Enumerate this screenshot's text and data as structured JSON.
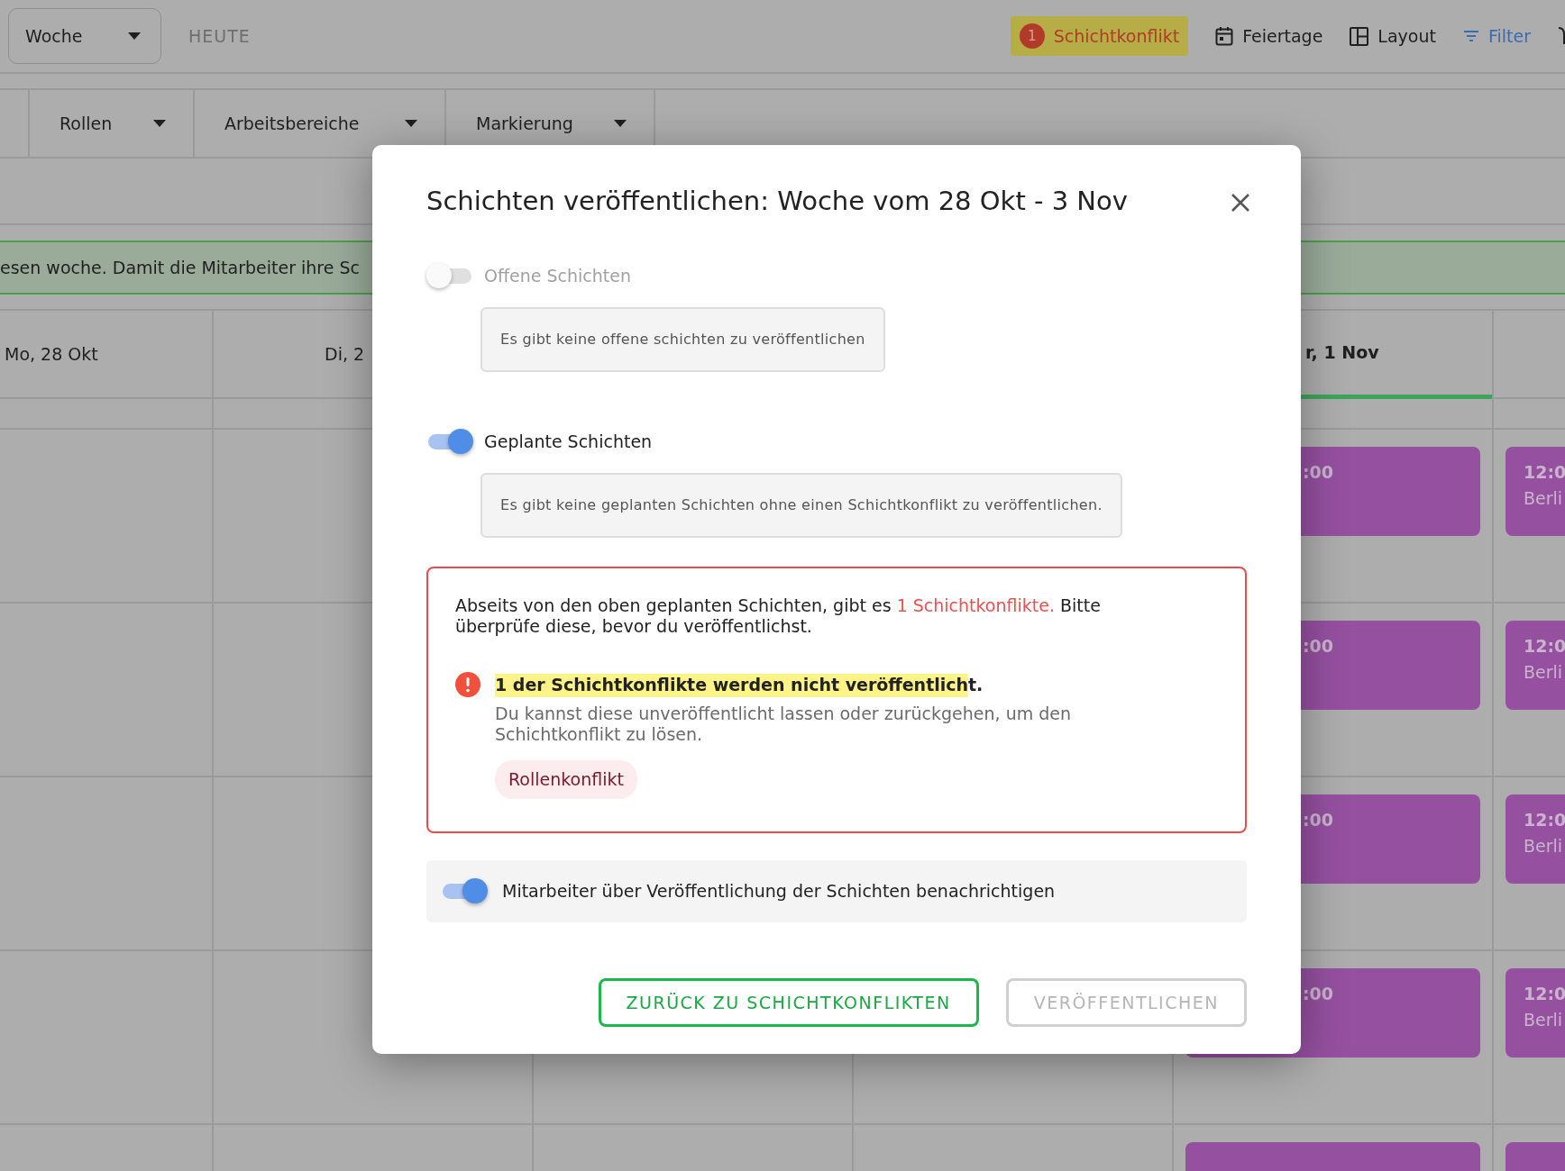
{
  "toolbar": {
    "view_select": "Woche",
    "today": "HEUTE",
    "conflict_count": "1",
    "conflict_label": "Schichtkonflikt",
    "holidays": "Feiertage",
    "layout": "Layout",
    "filter": "Filter"
  },
  "filters": [
    "Rollen",
    "Arbeitsbereiche",
    "Markierung"
  ],
  "banner": "esen woche. Damit die Mitarbeiter ihre Sc",
  "days": [
    {
      "label": "Mo, 28 Okt",
      "selected": false
    },
    {
      "label": "Di, 2",
      "selected": false
    },
    {
      "label": "r, 1 Nov",
      "selected": true,
      "shifts": [
        {
          "time": ":00"
        },
        {
          "time": ":00"
        },
        {
          "time": ":00"
        },
        {
          "time": ":00"
        },
        {
          "kind": "clipped"
        }
      ]
    },
    {
      "selected": false,
      "shifts": [
        {
          "time": "12:0",
          "place": "Berli"
        },
        {
          "time": "12:0",
          "place": "Berli"
        },
        {
          "time": "12:0",
          "place": "Berli"
        },
        {
          "time": "12:0",
          "place": "Berli"
        },
        {
          "kind": "clipped"
        }
      ]
    }
  ],
  "modal": {
    "title": "Schichten veröffentlichen: Woche vom 28 Okt - 3 Nov",
    "sections": [
      {
        "label": "Offene Schichten",
        "on": false,
        "disabled": true,
        "note": "Es gibt keine offene schichten zu veröffentlichen"
      },
      {
        "label": "Geplante Schichten",
        "on": true,
        "disabled": false,
        "note": "Es gibt keine geplanten Schichten ohne einen Schichtkonflikt zu veröffentlichen."
      }
    ],
    "conflicts": {
      "text_before": "Abseits von den oben geplanten Schichten, gibt es ",
      "link": "1 Schichtkonflikte.",
      "text_after": " Bitte überprüfe diese, bevor du veröffentlichst.",
      "warning_title": "1 der Schichtkonflikte werden nicht veröffentlicht.",
      "warning_text": "Du kannst diese unveröffentlicht lassen oder zurückgehen, um den Schichtkonflikt zu lösen.",
      "tags": [
        "Rollenkonflikt"
      ]
    },
    "notify": {
      "label": "Mitarbeiter über Veröffentlichung der Schichten benachrichtigen",
      "on": true
    },
    "buttons": [
      {
        "label": "ZURÜCK ZU SCHICHTKONFLIKTEN",
        "disabled": false
      },
      {
        "label": "VERÖFFENTLICHEN",
        "disabled": true
      }
    ]
  }
}
